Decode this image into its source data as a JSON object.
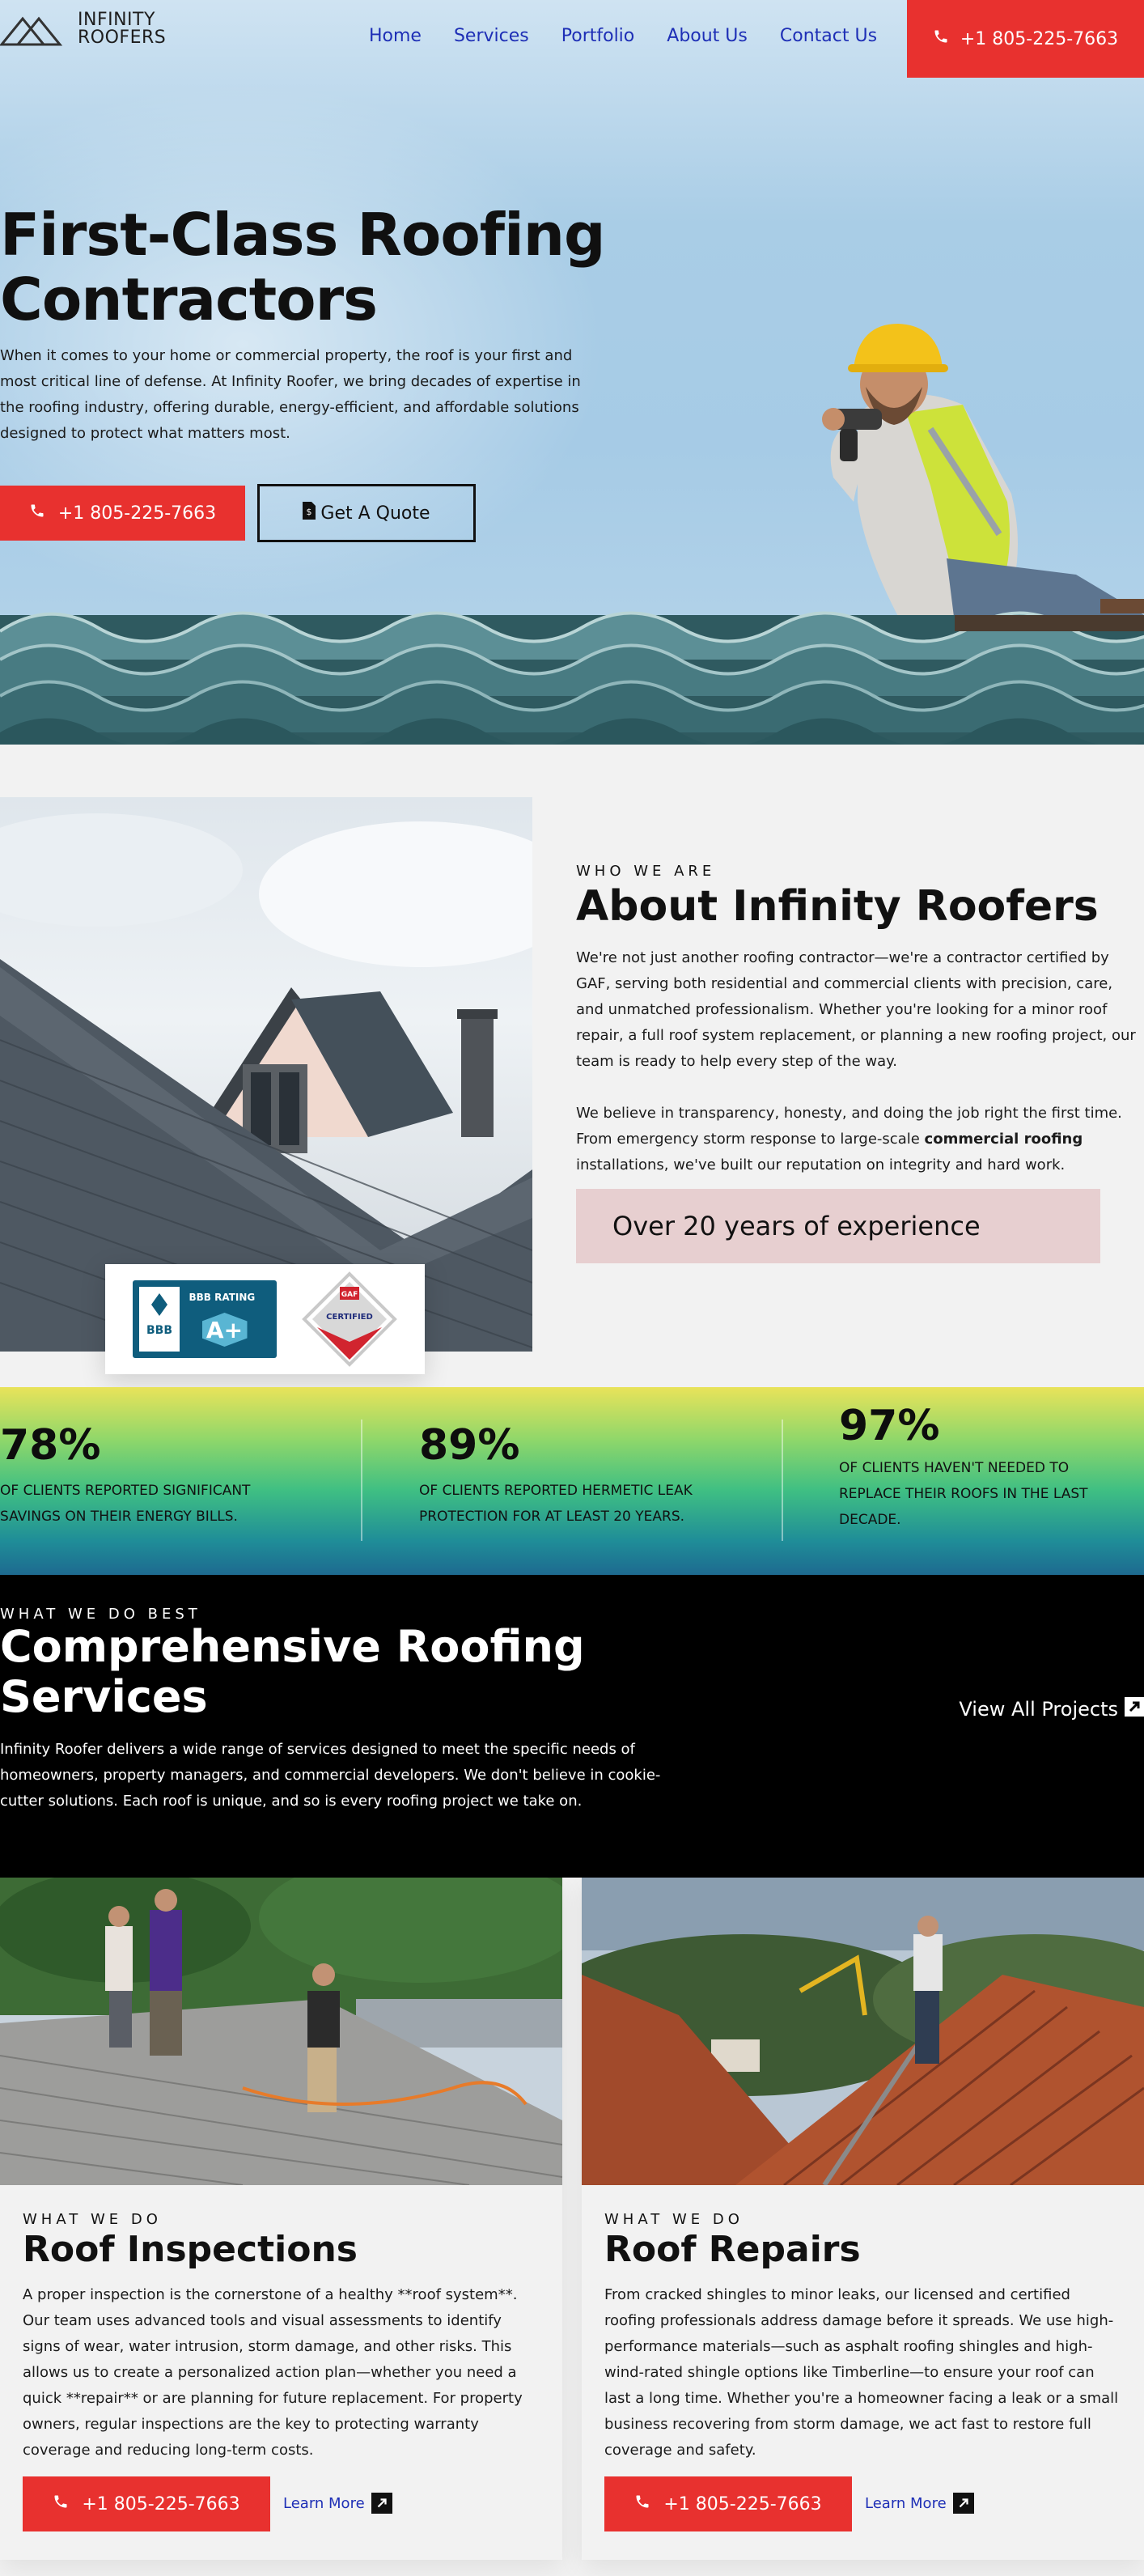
{
  "brand": {
    "line1": "INFINITY",
    "line2": "ROOFERS"
  },
  "nav": {
    "items": [
      "Home",
      "Services",
      "Portfolio",
      "About Us",
      "Contact Us"
    ],
    "phone": "+1 805-225-7663"
  },
  "hero": {
    "title_line1": "First-Class Roofing",
    "title_line2": "Contractors",
    "text": "When it comes to your home or commercial property, the roof is your first and most critical line of defense. At Infinity Roofer, we bring decades of expertise in the roofing industry, offering durable, energy-efficient, and affordable solutions designed to protect what matters most.",
    "phone": "+1 805-225-7663",
    "quote": "Get A Quote"
  },
  "about": {
    "eyebrow": "WHO WE ARE",
    "title": "About Infinity Roofers",
    "p1": "We're not just another roofing contractor—we're a contractor certified by GAF, serving both residential and commercial clients with precision, care, and unmatched professionalism. Whether you're looking for a minor roof repair, a full roof system replacement, or planning a new roofing project, our team is ready to help every step of the way.",
    "p2_before": "We believe in transparency, honesty, and doing the job right the first time. From emergency storm response to large-scale ",
    "p2_bold": "commercial roofing",
    "p2_after": " installations, we've built our reputation on integrity and hard work.",
    "experience": "Over 20 years of experience",
    "bbb_rating": "BBB RATING",
    "bbb_grade": "A+",
    "bbb_name": "BBB",
    "gaf_label": "GAF",
    "gaf_certified": "CERTIFIED"
  },
  "stats": [
    {
      "value": "78%",
      "text_l1": "OF CLIENTS REPORTED SIGNIFICANT",
      "text_l2": "SAVINGS ON THEIR ENERGY BILLS.",
      "text_l3": ""
    },
    {
      "value": "89%",
      "text_l1": "OF CLIENTS REPORTED HERMETIC LEAK",
      "text_l2": "PROTECTION FOR AT LEAST 20 YEARS.",
      "text_l3": ""
    },
    {
      "value": "97%",
      "text_l1": "OF CLIENTS HAVEN'T NEEDED TO",
      "text_l2": "REPLACE THEIR ROOFS IN THE LAST",
      "text_l3": "DECADE."
    }
  ],
  "services": {
    "eyebrow": "WHAT WE DO BEST",
    "title_line1": "Comprehensive Roofing",
    "title_line2": "Services",
    "text": "Infinity Roofer delivers a wide range of services designed to meet the specific needs of homeowners, property managers, and commercial developers. We don't believe in cookie-cutter solutions. Each roof is unique, and so is every roofing project we take on.",
    "view_all": "View All Projects"
  },
  "cards": [
    {
      "eyebrow": "WHAT WE DO",
      "title": "Roof Inspections",
      "text": "A proper inspection is the cornerstone of a healthy **roof system**. Our team uses advanced tools and visual assessments to identify signs of wear, water intrusion, storm damage, and other risks. This allows us to create a personalized action plan—whether you need a quick **repair** or are planning for future replacement. For property owners, regular inspections are the key to protecting warranty coverage and reducing long-term costs.",
      "phone": "+1 805-225-7663",
      "learn": "Learn More"
    },
    {
      "eyebrow": "WHAT WE DO",
      "title": "Roof Repairs",
      "text": "From cracked shingles to minor leaks, our licensed and certified roofing professionals address damage before it spreads. We use high-performance materials—such as asphalt roofing shingles and high-wind-rated shingle options like Timberline—to ensure your roof can last a long time. Whether you're a homeowner facing a leak or a small business recovering from storm damage, we act fast to restore full coverage and safety.",
      "phone": "+1 805-225-7663",
      "learn": "Learn More"
    }
  ],
  "colors": {
    "accent": "#e8312f",
    "nav": "#1e2fb6",
    "dark": "#000000",
    "experience_bg": "#e7cfd0"
  }
}
